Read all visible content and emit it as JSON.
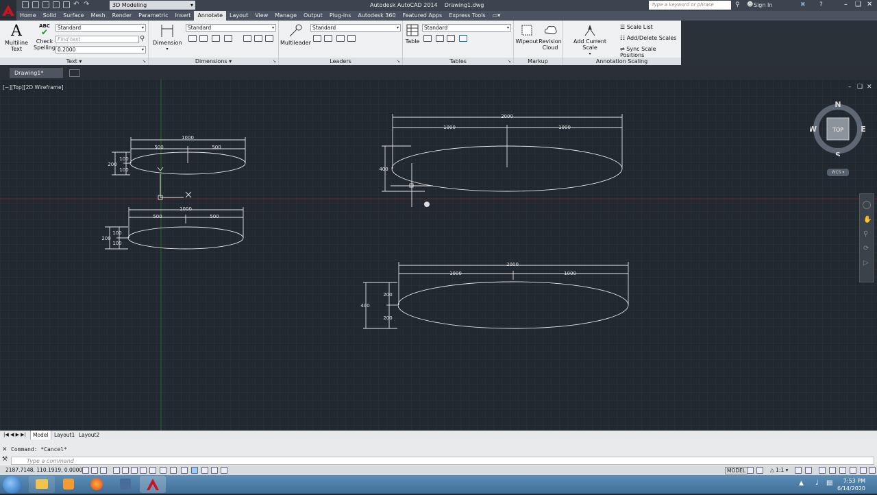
{
  "app": {
    "title": "Autodesk AutoCAD 2014    Drawing1.dwg",
    "workspace": "3D Modeling",
    "search_placeholder": "Type a keyword or phrase",
    "sign_in": "Sign In"
  },
  "ribbon_tabs": [
    "Home",
    "Solid",
    "Surface",
    "Mesh",
    "Render",
    "Parametric",
    "Insert",
    "Annotate",
    "Layout",
    "View",
    "Manage",
    "Output",
    "Plug-ins",
    "Autodesk 360",
    "Featured Apps",
    "Express Tools"
  ],
  "active_tab": "Annotate",
  "ribbon": {
    "text": {
      "title": "Text",
      "multiline_text": "Multiline\nText",
      "check_spelling": "Check\nSpelling",
      "check_spelling_icon_text": "ABC",
      "style": "Standard",
      "find_placeholder": "Find text",
      "height": "0.2000"
    },
    "dimensions": {
      "title": "Dimensions",
      "dimension": "Dimension",
      "style": "Standard"
    },
    "leaders": {
      "title": "Leaders",
      "multileader": "Multileader",
      "style": "Standard"
    },
    "tables": {
      "title": "Tables",
      "table": "Table",
      "style": "Standard"
    },
    "markup": {
      "title": "Markup",
      "wipeout": "Wipeout",
      "revision_cloud": "Revision\nCloud"
    },
    "annotation_scaling": {
      "title": "Annotation Scaling",
      "add_current_scale": "Add Current Scale",
      "scale_list": "Scale List",
      "add_delete_scales": "Add/Delete Scales",
      "sync_scale_positions": "Sync Scale Positions"
    }
  },
  "document_tab": "Drawing1*",
  "viewport": {
    "label": "[−][Top][2D Wireframe]",
    "viewcube": {
      "top": "TOP",
      "n": "N",
      "s": "S",
      "e": "E",
      "w": "W",
      "wcs": "WCS"
    }
  },
  "drawing": {
    "e1": {
      "overall": "1000",
      "half_left": "500",
      "half_right": "500",
      "height": "200",
      "upper": "100",
      "lower": "100"
    },
    "e2": {
      "overall": "1000",
      "half_left": "500",
      "half_right": "500",
      "height": "200",
      "upper": "100",
      "lower": "100"
    },
    "e3": {
      "overall": "2000",
      "half_left": "1000",
      "half_right": "1000",
      "height": "400"
    },
    "e4": {
      "overall": "2000",
      "half_left": "1000",
      "half_right": "1000",
      "height": "400",
      "upper": "200",
      "lower": "200"
    }
  },
  "layout_tabs": [
    "Model",
    "Layout1",
    "Layout2"
  ],
  "command": {
    "history": "Command: *Cancel*",
    "placeholder": "Type a command"
  },
  "status": {
    "coordinates": "2187.7148, 110.1919, 0.0000",
    "model": "MODEL",
    "scale": "1:1"
  },
  "clock": {
    "time": "7:53 PM",
    "date": "6/14/2020"
  },
  "colors": {
    "canvas": "#212830",
    "ribbon": "#eef0f2",
    "tabs": "#4b5360",
    "autocad_red": "#c8141e"
  }
}
